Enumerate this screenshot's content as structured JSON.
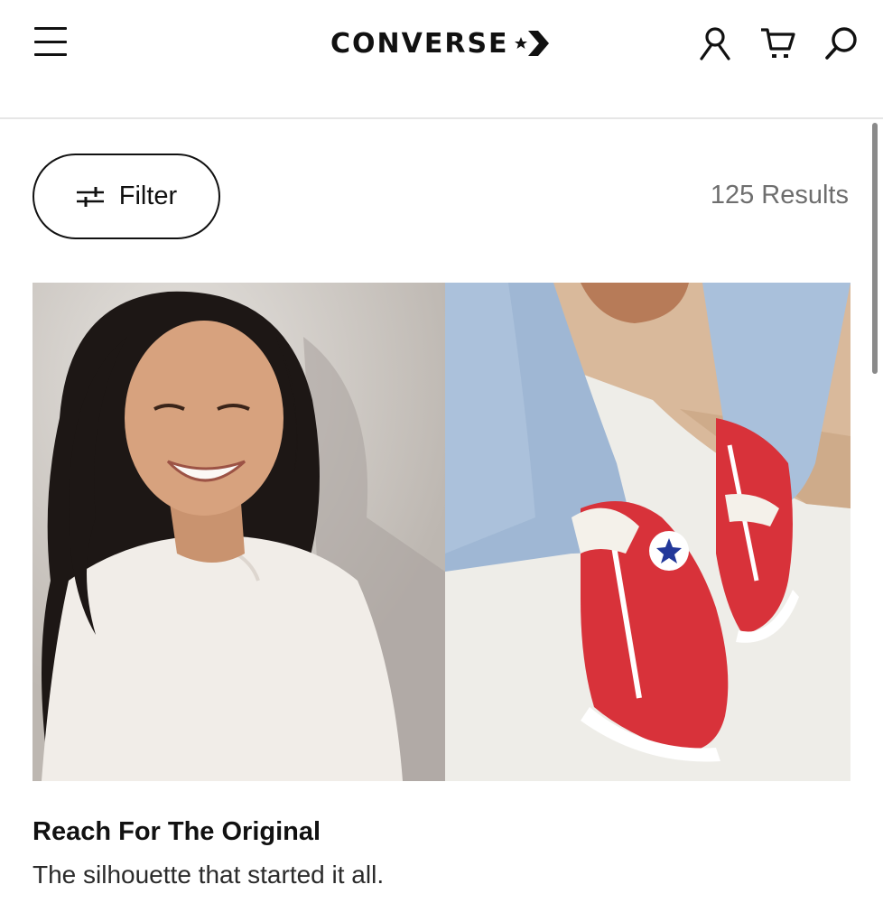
{
  "header": {
    "brand": "CONVERSE",
    "menu_icon": "hamburger-menu-icon",
    "logo_icon": "star-chevron-logo-icon",
    "account_icon": "user-icon",
    "cart_icon": "cart-icon",
    "search_icon": "search-icon"
  },
  "toolbar": {
    "filter_label": "Filter",
    "filter_icon": "sliders-icon",
    "results_text": "125 Results"
  },
  "hero": {
    "left_image": "smiling-woman-white-tee-photo",
    "right_image": "red-high-top-sneakers-photo",
    "title": "Reach For The Original",
    "subtitle": "The silhouette that started it all."
  },
  "colors": {
    "text": "#111111",
    "muted": "#6e6e6e",
    "sneaker_red": "#d8323a",
    "denim": "#9fb7d4"
  }
}
